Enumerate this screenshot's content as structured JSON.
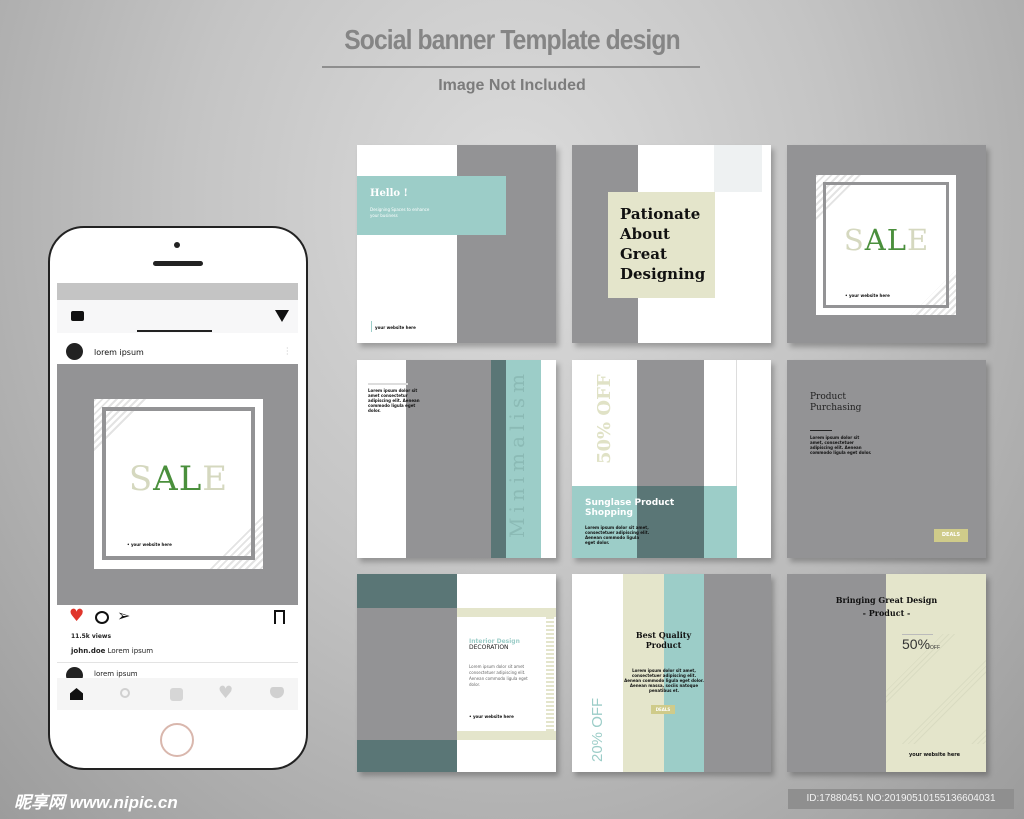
{
  "header": {
    "title": "Social banner Template design",
    "subtitle": "Image Not Included"
  },
  "colors": {
    "gray": "#939395",
    "teal": "#9ccdc8",
    "dark_teal": "#5a7676",
    "cream": "#e4e5cb",
    "sale_green": "#4a8f3c",
    "sale_light": "#d5d8bf",
    "deals": "#cfcb8a"
  },
  "cards": {
    "c1": {
      "title": "Hello !",
      "text": "Designing Spaces to enhance your business",
      "website": "your website here"
    },
    "c2": {
      "lines": [
        "Pationate",
        "About",
        "Great",
        "Designing"
      ]
    },
    "c3": {
      "s": "S",
      "a": "A",
      "l": "L",
      "e": "E",
      "website": "• your website here"
    },
    "c4": {
      "text": "Lorem ipsum dolor sit amet consectetur adipiscing elit. Aenean commodo ligula eget dolor.",
      "vertical": "Minimalism"
    },
    "c5": {
      "vertical": "50% OFF",
      "title": "Sunglase Product Shopping",
      "text": "Lorem ipsum dolor sit amet, consectetuer adipiscing elit. Aenean commodo ligula eget dolor."
    },
    "c6": {
      "title1": "Product",
      "title2": "Purchasing",
      "text": "Lorem ipsum dolor sit amet, consectetuer adipiscing elit. Aenean commodo ligula eget dolor.",
      "button": "DEALS"
    },
    "c7": {
      "title": "Interior Design",
      "subtitle": "DECORATION",
      "text": "Lorem ipsum dolor sit amet consectetuer adipiscing elit. Aenean commodo ligula eget dolor.",
      "website": "• your website here"
    },
    "c8": {
      "title": "Best Quality Product",
      "text": "Lorem ipsum dolor sit amet, consectetuer adipiscing elit. Aenean commodo ligula eget dolor. Aenean massa, sociis natoque penatibus et.",
      "button": "DEALS",
      "vertical": "20% OFF"
    },
    "c9": {
      "title": "Bringing Great Design",
      "subtitle": "- Product -",
      "pct": "50%",
      "off": "OFF",
      "website": "your website here"
    }
  },
  "phone": {
    "username": "lorem ipsum",
    "views": "11.5k views",
    "caption_user": "john.doe",
    "caption": "Lorem ipsum",
    "next_user": "lorem ipsum",
    "icons": [
      "camera-icon",
      "send-icon",
      "heart-icon",
      "comment-icon",
      "share-icon",
      "bookmark-icon",
      "home-icon",
      "search-icon",
      "add-icon",
      "activity-icon",
      "profile-icon"
    ]
  },
  "watermark": {
    "brand": "昵享网 www.nipic.cn",
    "id": "ID:17880451 NO:20190510155136604031"
  }
}
